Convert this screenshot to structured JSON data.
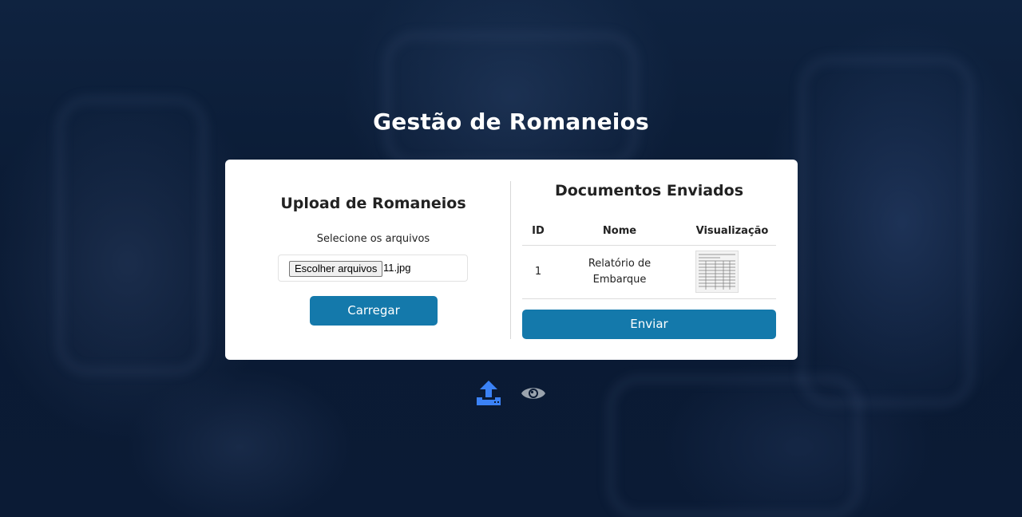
{
  "page": {
    "title": "Gestão de Romaneios"
  },
  "upload": {
    "heading": "Upload de Romaneios",
    "select_label": "Selecione os arquivos",
    "file_button_label": "Escolher arquivos",
    "selected_file": "11.jpg",
    "submit_label": "Carregar"
  },
  "documents": {
    "heading": "Documentos Enviados",
    "columns": [
      "ID",
      "Nome",
      "Visualização"
    ],
    "rows": [
      {
        "id": "1",
        "nome": "Relatório de Embarque",
        "preview_icon": "document-thumbnail"
      }
    ],
    "send_label": "Enviar"
  },
  "nav": {
    "upload_icon": "upload-icon",
    "view_icon": "eye-icon"
  },
  "colors": {
    "primary": "#1479ab",
    "upload_icon": "#3b82f6",
    "eye_icon": "#9aa3ad"
  }
}
